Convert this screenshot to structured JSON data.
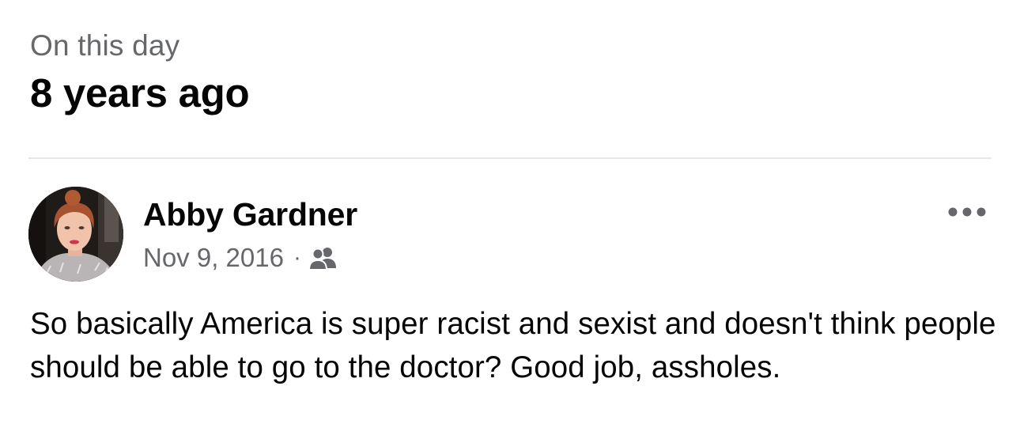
{
  "memories": {
    "kicker": "On this day",
    "title": "8 years ago"
  },
  "post": {
    "author": "Abby Gardner",
    "date": "Nov 9, 2016",
    "separator": "·",
    "audience_icon": "friends-icon",
    "more_icon": "more-options-icon",
    "text": "So basically America is super racist and sexist and doesn't think people should be able to go to the doctor? Good job, assholes."
  },
  "colors": {
    "primary_text": "#050505",
    "secondary_text": "#65676b",
    "divider": "#e4e6eb"
  }
}
